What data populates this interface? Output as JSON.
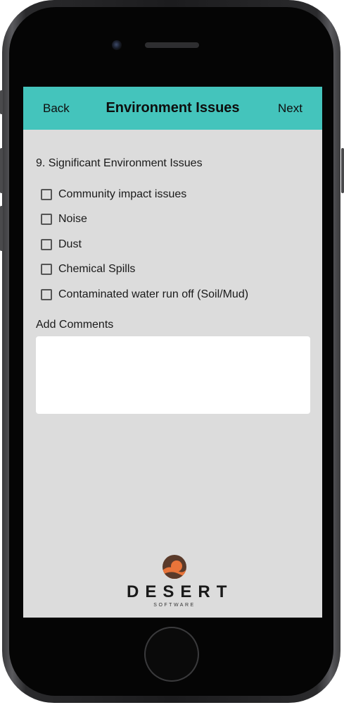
{
  "header": {
    "back_label": "Back",
    "title": "Environment Issues",
    "next_label": "Next",
    "color": "#44c4bc"
  },
  "question": {
    "label": "9. Significant Environment Issues",
    "options": [
      {
        "label": "Community impact issues",
        "checked": false
      },
      {
        "label": "Noise",
        "checked": false
      },
      {
        "label": "Dust",
        "checked": false
      },
      {
        "label": "Chemical Spills",
        "checked": false
      },
      {
        "label": "Contaminated water run off (Soil/Mud)",
        "checked": false
      }
    ]
  },
  "comments": {
    "label": "Add Comments",
    "value": ""
  },
  "logo": {
    "word": "DESERT",
    "sub": "SOFTWARE",
    "icon": "desert-sun-icon",
    "colors": {
      "sun": "#e8743a",
      "dune": "#5a3a2a"
    }
  }
}
